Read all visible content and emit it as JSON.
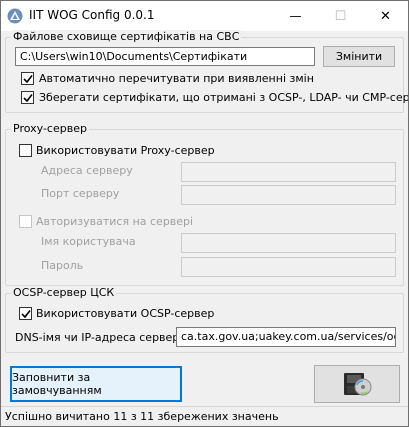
{
  "window": {
    "title": "IIT WOG Config 0.0.1",
    "minimize": "—",
    "maximize": "☐",
    "close": "✕",
    "icon": "app-triangle-icon"
  },
  "storage_group": {
    "label": "Файлове сховище сертифікатів на СВС",
    "path_value": "C:\\Users\\win10\\Documents\\Сертифікати",
    "change_button": "Змінити",
    "auto_reread": {
      "label": "Автоматично перечитувати при виявленні змін",
      "checked": true
    },
    "save_certs": {
      "label": "Зберегати сертифікати, що отримані з OCSP-, LDAP- чи CMP-серверів",
      "checked": true
    }
  },
  "proxy_group": {
    "label": "Proxy-сервер",
    "use_proxy": {
      "label": "Використовувати Proxy-сервер",
      "checked": false
    },
    "address_label": "Адреса серверу",
    "address_value": "",
    "port_label": "Порт серверу",
    "port_value": "",
    "authorize": {
      "label": "Авторизуватися на сервері",
      "checked": false
    },
    "username_label": "Імя користувача",
    "username_value": "",
    "password_label": "Пароль",
    "password_value": ""
  },
  "ocsp_group": {
    "label": "OCSP-сервер ЦСК",
    "use_ocsp": {
      "label": "Використовувати OCSP-сервер",
      "checked": true
    },
    "dns_label": "DNS-імя чи IP-адреса сервера:",
    "dns_value": "ca.tax.gov.ua;uakey.com.ua/services/ocsp/"
  },
  "buttons": {
    "defaults": "Заповнити за замовчуванням",
    "save_icon": "disk-save-icon"
  },
  "status": "Успішно вичитано 11 з 11 збережених значень",
  "colors": {
    "accent": "#0078d7",
    "check": "#000000"
  }
}
